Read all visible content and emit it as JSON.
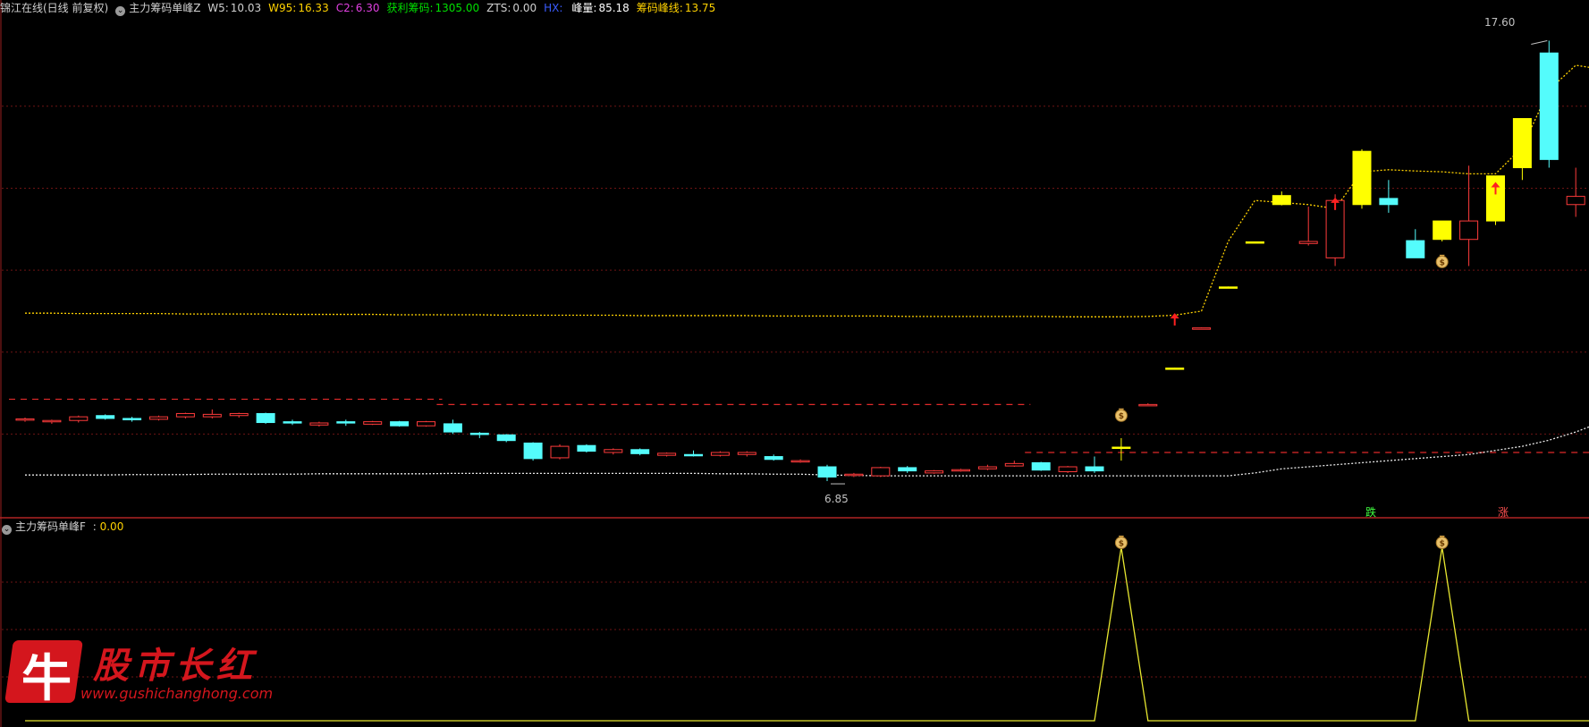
{
  "header_main": {
    "stock_name": "锦江在线(日线 前复权)",
    "indicator_name": "主力筹码单峰Z",
    "fields": [
      {
        "label": "W5:",
        "value": "10.03",
        "label_color": "#d0d0d0",
        "value_color": "#d0d0d0"
      },
      {
        "label": "W95:",
        "value": "16.33",
        "label_color": "#ffd200",
        "value_color": "#ffd200"
      },
      {
        "label": "C2:",
        "value": "6.30",
        "label_color": "#e040e0",
        "value_color": "#e040e0"
      },
      {
        "label": "获利筹码:",
        "value": "1305.00",
        "label_color": "#00e000",
        "value_color": "#00e000"
      },
      {
        "label": "ZTS:",
        "value": "0.00",
        "label_color": "#d0d0d0",
        "value_color": "#d0d0d0"
      },
      {
        "label": "HX:",
        "value": "",
        "label_color": "#3a5cff",
        "value_color": "#3a5cff"
      },
      {
        "label": "峰量:",
        "value": "85.18",
        "label_color": "#ffffff",
        "value_color": "#ffffff"
      },
      {
        "label": "筹码峰线:",
        "value": "13.75",
        "label_color": "#ffd200",
        "value_color": "#ffd200"
      }
    ]
  },
  "header_sub": {
    "indicator_name": "主力筹码单峰F",
    "sep": ":",
    "value": "0.00"
  },
  "annotations": {
    "high_label": "17.60",
    "low_label": "6.85",
    "tag_die": "跌",
    "tag_zhang": "涨"
  },
  "colors": {
    "up": "#ff3b3b",
    "down": "#54fcfc",
    "signal": "#ffff00",
    "grid": "#6e1414",
    "ma": "#ffd200",
    "white_line": "#e8e8e8"
  },
  "watermark": {
    "logo_char": "牛",
    "title": "股市长红",
    "url": "www.gushichanghong.com"
  },
  "icons": [
    "money-bag-icon",
    "red-up-arrow-icon",
    "collapse-circle-icon"
  ],
  "chart_data": [
    {
      "type": "candlestick",
      "title": "",
      "ylim": [
        6.0,
        18.2
      ],
      "candles": [
        {
          "o": 8.35,
          "h": 8.4,
          "l": 8.3,
          "c": 8.37,
          "s": "up"
        },
        {
          "o": 8.3,
          "h": 8.35,
          "l": 8.25,
          "c": 8.33,
          "s": "up"
        },
        {
          "o": 8.33,
          "h": 8.45,
          "l": 8.28,
          "c": 8.42,
          "s": "up"
        },
        {
          "o": 8.45,
          "h": 8.48,
          "l": 8.35,
          "c": 8.38,
          "s": "down"
        },
        {
          "o": 8.38,
          "h": 8.42,
          "l": 8.3,
          "c": 8.35,
          "s": "down"
        },
        {
          "o": 8.36,
          "h": 8.45,
          "l": 8.33,
          "c": 8.42,
          "s": "up"
        },
        {
          "o": 8.42,
          "h": 8.52,
          "l": 8.38,
          "c": 8.5,
          "s": "up"
        },
        {
          "o": 8.42,
          "h": 8.6,
          "l": 8.38,
          "c": 8.48,
          "s": "up"
        },
        {
          "o": 8.45,
          "h": 8.52,
          "l": 8.4,
          "c": 8.5,
          "s": "up"
        },
        {
          "o": 8.5,
          "h": 8.52,
          "l": 8.25,
          "c": 8.28,
          "s": "down"
        },
        {
          "o": 8.3,
          "h": 8.35,
          "l": 8.22,
          "c": 8.28,
          "s": "down"
        },
        {
          "o": 8.22,
          "h": 8.3,
          "l": 8.18,
          "c": 8.27,
          "s": "up"
        },
        {
          "o": 8.3,
          "h": 8.35,
          "l": 8.2,
          "c": 8.28,
          "s": "down"
        },
        {
          "o": 8.24,
          "h": 8.32,
          "l": 8.22,
          "c": 8.3,
          "s": "up"
        },
        {
          "o": 8.3,
          "h": 8.32,
          "l": 8.18,
          "c": 8.2,
          "s": "down"
        },
        {
          "o": 8.2,
          "h": 8.32,
          "l": 8.18,
          "c": 8.3,
          "s": "up"
        },
        {
          "o": 8.25,
          "h": 8.35,
          "l": 8.0,
          "c": 8.05,
          "s": "down"
        },
        {
          "o": 8.02,
          "h": 8.05,
          "l": 7.9,
          "c": 8.0,
          "s": "down"
        },
        {
          "o": 7.98,
          "h": 8.0,
          "l": 7.8,
          "c": 7.84,
          "s": "down"
        },
        {
          "o": 7.78,
          "h": 7.8,
          "l": 7.35,
          "c": 7.4,
          "s": "down"
        },
        {
          "o": 7.42,
          "h": 7.75,
          "l": 7.38,
          "c": 7.7,
          "s": "up"
        },
        {
          "o": 7.72,
          "h": 7.75,
          "l": 7.55,
          "c": 7.58,
          "s": "down"
        },
        {
          "o": 7.55,
          "h": 7.65,
          "l": 7.5,
          "c": 7.62,
          "s": "up"
        },
        {
          "o": 7.62,
          "h": 7.65,
          "l": 7.48,
          "c": 7.52,
          "s": "down"
        },
        {
          "o": 7.48,
          "h": 7.55,
          "l": 7.45,
          "c": 7.53,
          "s": "up"
        },
        {
          "o": 7.5,
          "h": 7.6,
          "l": 7.45,
          "c": 7.48,
          "s": "down"
        },
        {
          "o": 7.48,
          "h": 7.58,
          "l": 7.45,
          "c": 7.55,
          "s": "up"
        },
        {
          "o": 7.5,
          "h": 7.58,
          "l": 7.45,
          "c": 7.55,
          "s": "up"
        },
        {
          "o": 7.45,
          "h": 7.5,
          "l": 7.35,
          "c": 7.38,
          "s": "down"
        },
        {
          "o": 7.35,
          "h": 7.38,
          "l": 7.3,
          "c": 7.32,
          "s": "up"
        },
        {
          "o": 7.2,
          "h": 7.25,
          "l": 6.85,
          "c": 6.95,
          "s": "down"
        },
        {
          "o": 7.0,
          "h": 7.05,
          "l": 6.95,
          "c": 7.02,
          "s": "up"
        },
        {
          "o": 6.98,
          "h": 7.2,
          "l": 6.95,
          "c": 7.18,
          "s": "up"
        },
        {
          "o": 7.18,
          "h": 7.22,
          "l": 7.05,
          "c": 7.1,
          "s": "down"
        },
        {
          "o": 7.05,
          "h": 7.12,
          "l": 7.03,
          "c": 7.1,
          "s": "up"
        },
        {
          "o": 7.1,
          "h": 7.15,
          "l": 7.08,
          "c": 7.13,
          "s": "up"
        },
        {
          "o": 7.15,
          "h": 7.25,
          "l": 7.12,
          "c": 7.2,
          "s": "up"
        },
        {
          "o": 7.22,
          "h": 7.35,
          "l": 7.2,
          "c": 7.28,
          "s": "up"
        },
        {
          "o": 7.3,
          "h": 7.32,
          "l": 7.1,
          "c": 7.12,
          "s": "down"
        },
        {
          "o": 7.08,
          "h": 7.22,
          "l": 7.05,
          "c": 7.2,
          "s": "up"
        },
        {
          "o": 7.2,
          "h": 7.45,
          "l": 7.05,
          "c": 7.1,
          "s": "down"
        },
        {
          "o": 7.65,
          "h": 7.9,
          "l": 7.35,
          "c": 7.68,
          "s": "signal"
        },
        {
          "o": 8.7,
          "h": 8.75,
          "l": 8.7,
          "c": 8.72,
          "s": "up"
        },
        {
          "o": 9.6,
          "h": 9.62,
          "l": 9.6,
          "c": 9.61,
          "s": "signal"
        },
        {
          "o": 10.58,
          "h": 10.6,
          "l": 10.58,
          "c": 10.59,
          "s": "up"
        },
        {
          "o": 11.58,
          "h": 11.6,
          "l": 11.58,
          "c": 11.59,
          "s": "signal"
        },
        {
          "o": 12.68,
          "h": 12.7,
          "l": 12.68,
          "c": 12.69,
          "s": "signal"
        },
        {
          "o": 13.6,
          "h": 13.92,
          "l": 13.58,
          "c": 13.82,
          "s": "signal"
        },
        {
          "o": 12.65,
          "h": 13.55,
          "l": 12.6,
          "c": 12.7,
          "s": "up"
        },
        {
          "o": 12.3,
          "h": 13.85,
          "l": 12.1,
          "c": 13.7,
          "s": "up"
        },
        {
          "o": 13.6,
          "h": 14.95,
          "l": 13.5,
          "c": 14.9,
          "s": "signal"
        },
        {
          "o": 13.75,
          "h": 14.2,
          "l": 13.4,
          "c": 13.6,
          "s": "down"
        },
        {
          "o": 12.72,
          "h": 13.0,
          "l": 12.3,
          "c": 12.3,
          "s": "down"
        },
        {
          "o": 12.75,
          "h": 13.2,
          "l": 12.7,
          "c": 13.2,
          "s": "signal"
        },
        {
          "o": 12.75,
          "h": 14.55,
          "l": 12.1,
          "c": 13.2,
          "s": "up"
        },
        {
          "o": 13.2,
          "h": 14.3,
          "l": 13.1,
          "c": 14.3,
          "s": "signal"
        },
        {
          "o": 14.5,
          "h": 15.7,
          "l": 14.2,
          "c": 15.7,
          "s": "signal"
        },
        {
          "o": 17.3,
          "h": 17.6,
          "l": 14.5,
          "c": 14.7,
          "s": "down"
        },
        {
          "o": 13.6,
          "h": 14.5,
          "l": 13.3,
          "c": 13.8,
          "s": "up"
        },
        {
          "o": 13.8,
          "h": 14.7,
          "l": 13.3,
          "c": 13.95,
          "s": "up"
        }
      ],
      "dotted_line_yellow": [
        10.95,
        10.95,
        10.94,
        10.94,
        10.94,
        10.94,
        10.93,
        10.93,
        10.93,
        10.93,
        10.92,
        10.92,
        10.92,
        10.92,
        10.91,
        10.91,
        10.91,
        10.91,
        10.9,
        10.9,
        10.9,
        10.9,
        10.9,
        10.89,
        10.89,
        10.89,
        10.89,
        10.89,
        10.88,
        10.88,
        10.88,
        10.88,
        10.88,
        10.87,
        10.87,
        10.87,
        10.87,
        10.87,
        10.87,
        10.86,
        10.86,
        10.86,
        10.87,
        10.9,
        11.0,
        12.7,
        13.7,
        13.65,
        13.6,
        13.5,
        14.4,
        14.45,
        14.42,
        14.4,
        14.35,
        14.35,
        15.0,
        16.4,
        17.0,
        16.9,
        16.8
      ],
      "dotted_line_white": [
        7.0,
        7.0,
        7.0,
        7.0,
        7.01,
        7.01,
        7.01,
        7.02,
        7.02,
        7.02,
        7.02,
        7.03,
        7.03,
        7.03,
        7.03,
        7.03,
        7.04,
        7.04,
        7.04,
        7.04,
        7.04,
        7.04,
        7.04,
        7.04,
        7.04,
        7.04,
        7.03,
        7.03,
        7.02,
        7.02,
        7.0,
        6.99,
        6.98,
        6.98,
        6.98,
        6.98,
        6.98,
        6.98,
        6.98,
        6.98,
        6.98,
        6.98,
        6.98,
        6.98,
        6.98,
        6.98,
        7.05,
        7.15,
        7.2,
        7.25,
        7.3,
        7.35,
        7.4,
        7.45,
        7.5,
        7.6,
        7.7,
        7.85,
        8.05,
        8.3,
        8.85,
        9.0
      ],
      "red_dashed_levels": [
        {
          "y": 8.85,
          "from": 0,
          "to": 15
        },
        {
          "y": 8.72,
          "from": 16,
          "to": 37
        },
        {
          "y": 7.55,
          "from": 38,
          "to": 62
        }
      ],
      "grid_levels": [
        8.0,
        10.0,
        12.0,
        14.0,
        16.0
      ],
      "arrow_markers": [
        {
          "i": 43,
          "y": 10.8
        },
        {
          "i": 49,
          "y": 13.62
        },
        {
          "i": 55,
          "y": 14.0
        }
      ],
      "money_markers": [
        {
          "i": 41,
          "y": 8.45
        },
        {
          "i": 53,
          "y": 12.2
        }
      ]
    },
    {
      "type": "line",
      "title": "",
      "ylim": [
        0,
        1
      ],
      "series": [
        {
          "values": [
            0,
            0,
            0,
            0,
            0,
            0,
            0,
            0,
            0,
            0,
            0,
            0,
            0,
            0,
            0,
            0,
            0,
            0,
            0,
            0,
            0,
            0,
            0,
            0,
            0,
            0,
            0,
            0,
            0,
            0,
            0,
            0,
            0,
            0,
            0,
            0,
            0,
            0,
            0,
            0,
            0,
            1,
            0,
            0,
            0,
            0,
            0,
            0,
            0,
            0,
            0,
            0,
            0,
            1,
            0,
            0,
            0,
            0,
            0,
            0,
            0,
            0
          ]
        }
      ],
      "money_markers": [
        41,
        53
      ]
    }
  ]
}
